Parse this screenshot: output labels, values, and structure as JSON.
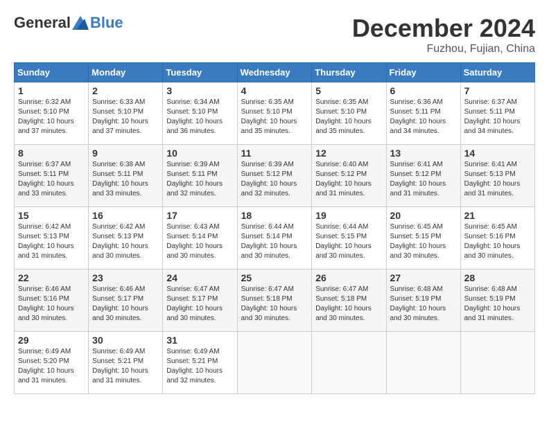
{
  "logo": {
    "general": "General",
    "blue": "Blue"
  },
  "header": {
    "title": "December 2024",
    "subtitle": "Fuzhou, Fujian, China"
  },
  "weekdays": [
    "Sunday",
    "Monday",
    "Tuesday",
    "Wednesday",
    "Thursday",
    "Friday",
    "Saturday"
  ],
  "weeks": [
    [
      {
        "day": "1",
        "sunrise": "6:32 AM",
        "sunset": "5:10 PM",
        "daylight": "10 hours and 37 minutes."
      },
      {
        "day": "2",
        "sunrise": "6:33 AM",
        "sunset": "5:10 PM",
        "daylight": "10 hours and 37 minutes."
      },
      {
        "day": "3",
        "sunrise": "6:34 AM",
        "sunset": "5:10 PM",
        "daylight": "10 hours and 36 minutes."
      },
      {
        "day": "4",
        "sunrise": "6:35 AM",
        "sunset": "5:10 PM",
        "daylight": "10 hours and 35 minutes."
      },
      {
        "day": "5",
        "sunrise": "6:35 AM",
        "sunset": "5:10 PM",
        "daylight": "10 hours and 35 minutes."
      },
      {
        "day": "6",
        "sunrise": "6:36 AM",
        "sunset": "5:11 PM",
        "daylight": "10 hours and 34 minutes."
      },
      {
        "day": "7",
        "sunrise": "6:37 AM",
        "sunset": "5:11 PM",
        "daylight": "10 hours and 34 minutes."
      }
    ],
    [
      {
        "day": "8",
        "sunrise": "6:37 AM",
        "sunset": "5:11 PM",
        "daylight": "10 hours and 33 minutes."
      },
      {
        "day": "9",
        "sunrise": "6:38 AM",
        "sunset": "5:11 PM",
        "daylight": "10 hours and 33 minutes."
      },
      {
        "day": "10",
        "sunrise": "6:39 AM",
        "sunset": "5:11 PM",
        "daylight": "10 hours and 32 minutes."
      },
      {
        "day": "11",
        "sunrise": "6:39 AM",
        "sunset": "5:12 PM",
        "daylight": "10 hours and 32 minutes."
      },
      {
        "day": "12",
        "sunrise": "6:40 AM",
        "sunset": "5:12 PM",
        "daylight": "10 hours and 31 minutes."
      },
      {
        "day": "13",
        "sunrise": "6:41 AM",
        "sunset": "5:12 PM",
        "daylight": "10 hours and 31 minutes."
      },
      {
        "day": "14",
        "sunrise": "6:41 AM",
        "sunset": "5:13 PM",
        "daylight": "10 hours and 31 minutes."
      }
    ],
    [
      {
        "day": "15",
        "sunrise": "6:42 AM",
        "sunset": "5:13 PM",
        "daylight": "10 hours and 31 minutes."
      },
      {
        "day": "16",
        "sunrise": "6:42 AM",
        "sunset": "5:13 PM",
        "daylight": "10 hours and 30 minutes."
      },
      {
        "day": "17",
        "sunrise": "6:43 AM",
        "sunset": "5:14 PM",
        "daylight": "10 hours and 30 minutes."
      },
      {
        "day": "18",
        "sunrise": "6:44 AM",
        "sunset": "5:14 PM",
        "daylight": "10 hours and 30 minutes."
      },
      {
        "day": "19",
        "sunrise": "6:44 AM",
        "sunset": "5:15 PM",
        "daylight": "10 hours and 30 minutes."
      },
      {
        "day": "20",
        "sunrise": "6:45 AM",
        "sunset": "5:15 PM",
        "daylight": "10 hours and 30 minutes."
      },
      {
        "day": "21",
        "sunrise": "6:45 AM",
        "sunset": "5:16 PM",
        "daylight": "10 hours and 30 minutes."
      }
    ],
    [
      {
        "day": "22",
        "sunrise": "6:46 AM",
        "sunset": "5:16 PM",
        "daylight": "10 hours and 30 minutes."
      },
      {
        "day": "23",
        "sunrise": "6:46 AM",
        "sunset": "5:17 PM",
        "daylight": "10 hours and 30 minutes."
      },
      {
        "day": "24",
        "sunrise": "6:47 AM",
        "sunset": "5:17 PM",
        "daylight": "10 hours and 30 minutes."
      },
      {
        "day": "25",
        "sunrise": "6:47 AM",
        "sunset": "5:18 PM",
        "daylight": "10 hours and 30 minutes."
      },
      {
        "day": "26",
        "sunrise": "6:47 AM",
        "sunset": "5:18 PM",
        "daylight": "10 hours and 30 minutes."
      },
      {
        "day": "27",
        "sunrise": "6:48 AM",
        "sunset": "5:19 PM",
        "daylight": "10 hours and 30 minutes."
      },
      {
        "day": "28",
        "sunrise": "6:48 AM",
        "sunset": "5:19 PM",
        "daylight": "10 hours and 31 minutes."
      }
    ],
    [
      {
        "day": "29",
        "sunrise": "6:49 AM",
        "sunset": "5:20 PM",
        "daylight": "10 hours and 31 minutes."
      },
      {
        "day": "30",
        "sunrise": "6:49 AM",
        "sunset": "5:21 PM",
        "daylight": "10 hours and 31 minutes."
      },
      {
        "day": "31",
        "sunrise": "6:49 AM",
        "sunset": "5:21 PM",
        "daylight": "10 hours and 32 minutes."
      },
      null,
      null,
      null,
      null
    ]
  ],
  "labels": {
    "sunrise": "Sunrise:",
    "sunset": "Sunset:",
    "daylight": "Daylight:"
  }
}
